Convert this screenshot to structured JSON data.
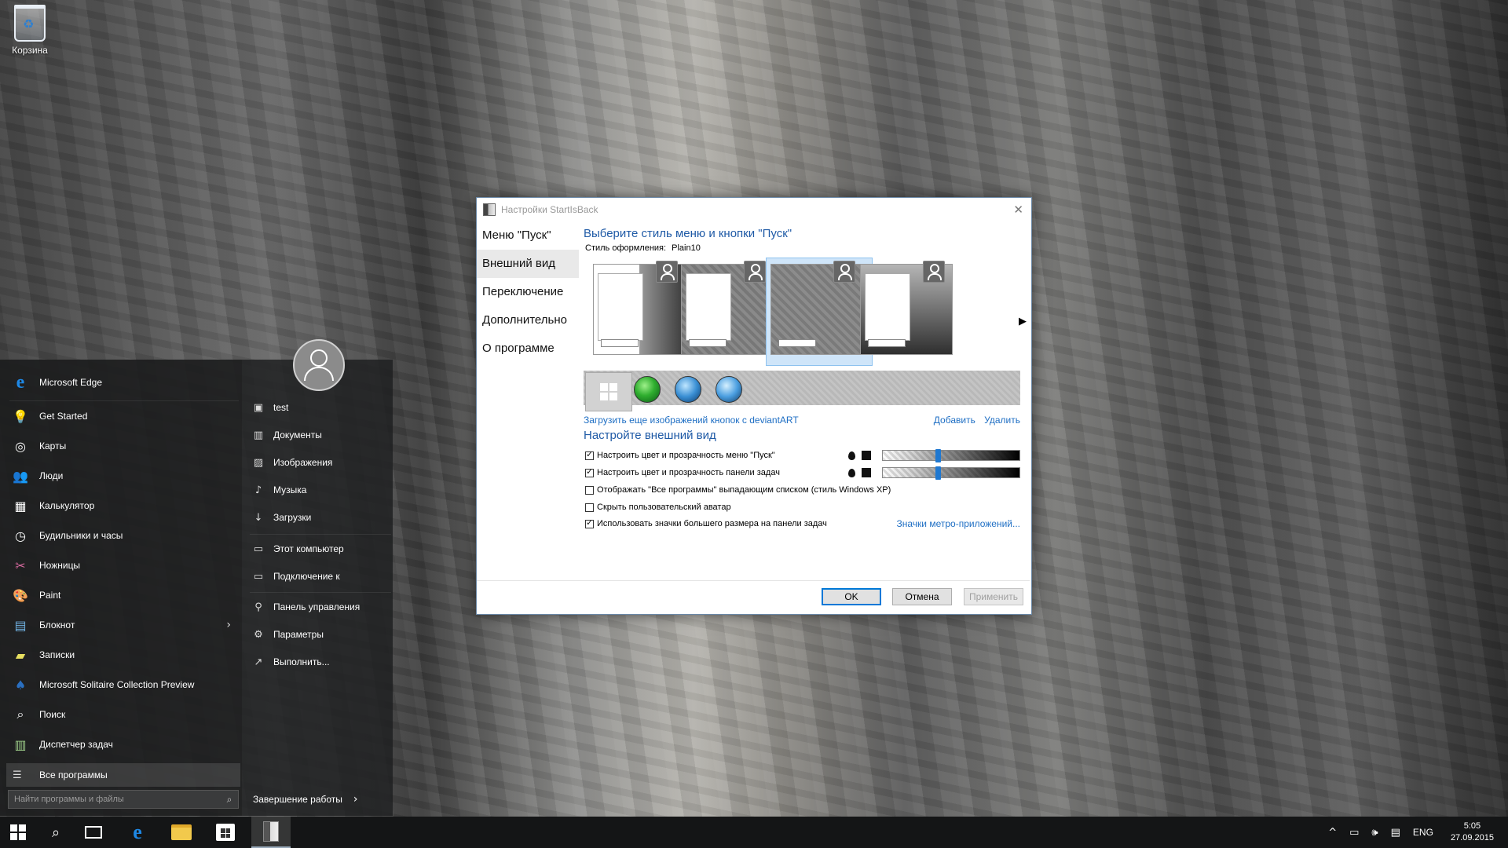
{
  "desktop": {
    "recycle_bin_label": "Корзина"
  },
  "start_menu": {
    "apps": [
      {
        "label": "Microsoft Edge",
        "icon": "edge-icon",
        "color": "#1e88e5"
      },
      {
        "label": "Get Started",
        "icon": "lightbulb-icon",
        "color": "#ffffff"
      },
      {
        "label": "Карты",
        "icon": "maps-icon",
        "color": "#ffffff"
      },
      {
        "label": "Люди",
        "icon": "people-icon",
        "color": "#ffffff"
      },
      {
        "label": "Калькулятор",
        "icon": "calculator-icon",
        "color": "#ffffff"
      },
      {
        "label": "Будильники и часы",
        "icon": "clock-icon",
        "color": "#ffffff"
      },
      {
        "label": "Ножницы",
        "icon": "scissors-icon",
        "color": "#d86aa0"
      },
      {
        "label": "Paint",
        "icon": "paint-icon",
        "color": "#f0c040"
      },
      {
        "label": "Блокнот",
        "icon": "notepad-icon",
        "color": "#6fb0e0"
      },
      {
        "label": "Записки",
        "icon": "sticky-notes-icon",
        "color": "#e8e060"
      },
      {
        "label": "Microsoft Solitaire Collection Preview",
        "icon": "cards-icon",
        "color": "#2a6fc0"
      },
      {
        "label": "Поиск",
        "icon": "search-icon",
        "color": "#ffffff"
      },
      {
        "label": "Диспетчер задач",
        "icon": "task-manager-icon",
        "color": "#9fd08a"
      }
    ],
    "all_programs_label": "Все программы",
    "search_placeholder": "Найти программы и файлы",
    "places": [
      {
        "label": "test",
        "icon": "user-folder-icon"
      },
      {
        "label": "Документы",
        "icon": "documents-icon"
      },
      {
        "label": "Изображения",
        "icon": "pictures-icon"
      },
      {
        "label": "Музыка",
        "icon": "music-icon"
      },
      {
        "label": "Загрузки",
        "icon": "downloads-icon"
      },
      {
        "label": "Этот компьютер",
        "icon": "computer-icon"
      },
      {
        "label": "Подключение к",
        "icon": "connect-icon"
      },
      {
        "label": "Панель управления",
        "icon": "control-panel-icon"
      },
      {
        "label": "Параметры",
        "icon": "settings-icon"
      },
      {
        "label": "Выполнить...",
        "icon": "run-icon"
      }
    ],
    "shutdown_label": "Завершение работы"
  },
  "dialog": {
    "title": "Настройки StartIsBack",
    "nav": [
      {
        "label": "Меню \"Пуск\""
      },
      {
        "label": "Внешний вид",
        "active": true
      },
      {
        "label": "Переключение"
      },
      {
        "label": "Дополнительно"
      },
      {
        "label": "О программе"
      }
    ],
    "heading_style": "Выберите стиль меню и кнопки \"Пуск\"",
    "style_label": "Стиль оформления:",
    "style_value": "Plain10",
    "selected_style_index": 2,
    "load_more_link": "Загрузить еще изображений кнопок с deviantART",
    "add_link": "Добавить",
    "delete_link": "Удалить",
    "heading_appearance": "Настройте внешний вид",
    "options": [
      {
        "label": "Настроить цвет и прозрачность меню \"Пуск\"",
        "checked": true,
        "slider": 0.4
      },
      {
        "label": "Настроить цвет и прозрачность панели задач",
        "checked": true,
        "slider": 0.4
      },
      {
        "label": "Отображать \"Все программы\" выпадающим списком (стиль Windows XP)",
        "checked": false
      },
      {
        "label": "Скрыть пользовательский аватар",
        "checked": false
      },
      {
        "label": "Использовать значки большего размера на панели задач",
        "checked": true
      }
    ],
    "metro_link": "Значки метро-приложений...",
    "ok_label": "OK",
    "cancel_label": "Отмена",
    "apply_label": "Применить"
  },
  "taskbar": {
    "lang": "ENG",
    "time": "5:05",
    "date": "27.09.2015"
  }
}
